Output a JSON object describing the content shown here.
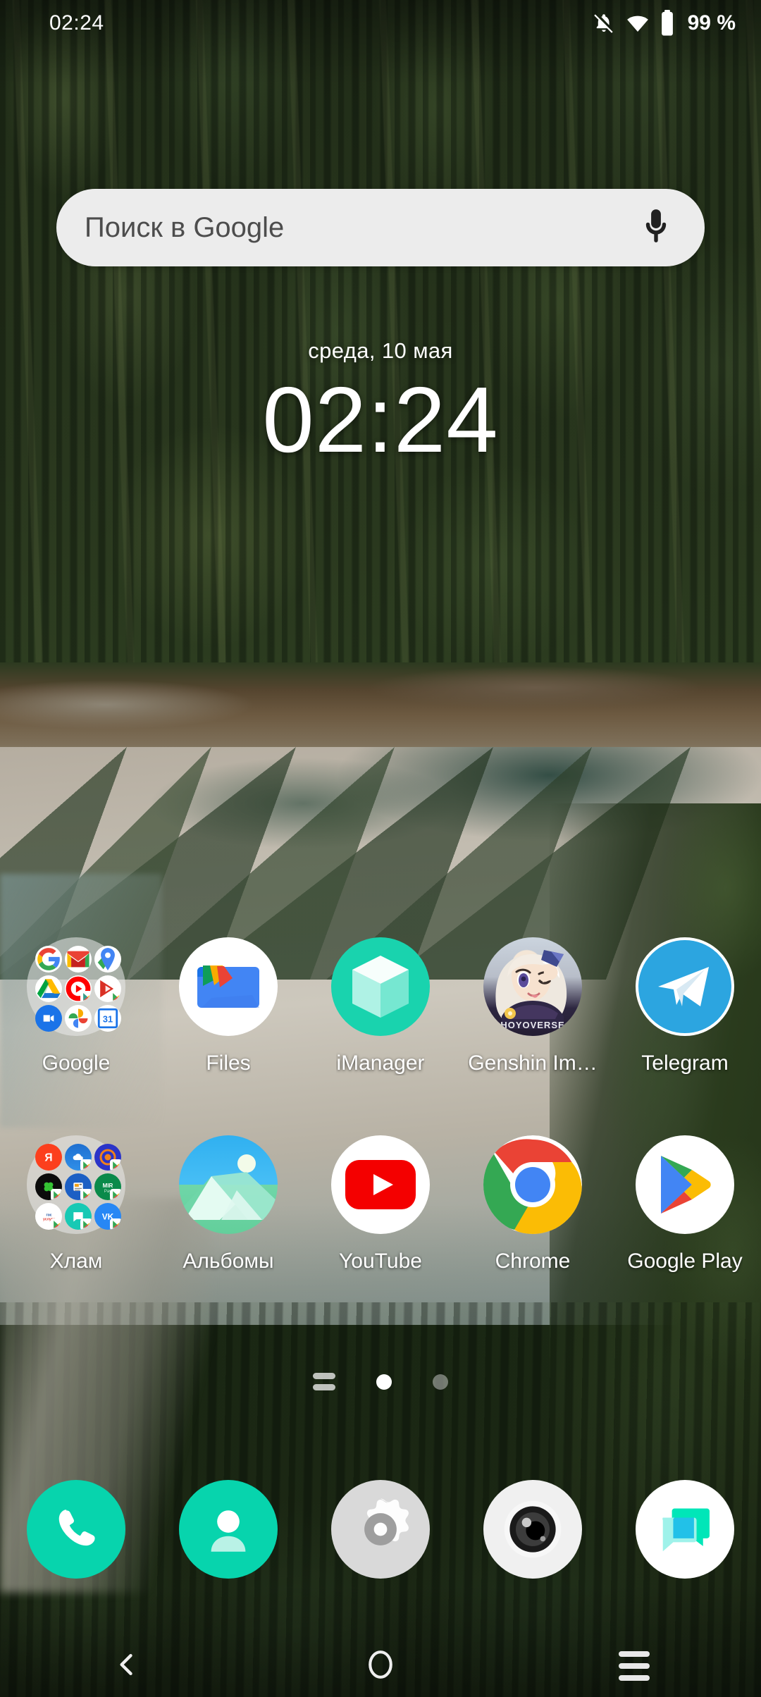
{
  "status_bar": {
    "time": "02:24",
    "battery_text": "99 %",
    "icons": [
      "bell-off-icon",
      "wifi-icon",
      "battery-icon"
    ]
  },
  "search": {
    "placeholder": "Поиск в Google",
    "mic_icon": "microphone-icon",
    "background_color": "#ececec"
  },
  "clock_widget": {
    "date": "среда, 10 мая",
    "time": "02:24"
  },
  "app_grid": {
    "rows": [
      [
        {
          "label": "Google",
          "type": "folder",
          "icon": "google-folder-icon"
        },
        {
          "label": "Files",
          "type": "app",
          "icon": "files-icon"
        },
        {
          "label": "iManager",
          "type": "app",
          "icon": "imanager-icon"
        },
        {
          "label": "Genshin Im…",
          "type": "app",
          "icon": "genshin-impact-icon"
        },
        {
          "label": "Telegram",
          "type": "app",
          "icon": "telegram-icon"
        }
      ],
      [
        {
          "label": "Хлам",
          "type": "folder",
          "icon": "junk-folder-icon"
        },
        {
          "label": "Альбомы",
          "type": "app",
          "icon": "albums-icon"
        },
        {
          "label": "YouTube",
          "type": "app",
          "icon": "youtube-icon"
        },
        {
          "label": "Chrome",
          "type": "app",
          "icon": "chrome-icon"
        },
        {
          "label": "Google Play",
          "type": "app",
          "icon": "google-play-icon"
        }
      ]
    ],
    "folders": {
      "google": {
        "name": "Google",
        "apps": [
          "google-search",
          "gmail",
          "maps",
          "drive",
          "youtube-music",
          "play-store",
          "meet",
          "photos",
          "calendar"
        ]
      },
      "junk": {
        "name": "Хлам",
        "apps": [
          "yandex",
          "cloud",
          "target",
          "clover",
          "news",
          "mir-pay",
          "gosuslugi",
          "messages",
          "vk"
        ]
      }
    }
  },
  "page_indicator": {
    "widget_handle": "widget-dash-icon",
    "pages": 2,
    "active_page": 1
  },
  "dock": {
    "items": [
      {
        "label": "Phone",
        "icon": "phone-icon",
        "color": "#07d4ad"
      },
      {
        "label": "Contacts",
        "icon": "contacts-icon",
        "color": "#07d4ad"
      },
      {
        "label": "Settings",
        "icon": "settings-gear-icon",
        "color": "#d9d9d9"
      },
      {
        "label": "Camera",
        "icon": "camera-icon",
        "color": "#ffffff"
      },
      {
        "label": "Messages",
        "icon": "messages-icon",
        "color": "#ffffff"
      }
    ]
  },
  "nav_bar": {
    "back": "back-chevron-icon",
    "home": "home-circle-icon",
    "recents": "recents-lines-icon"
  },
  "wallpaper": {
    "description": "aerial-forest-lake-photo",
    "dominant_colors": [
      "#1f2b16",
      "#6d5a41",
      "#c2bcb0",
      "#2a3b1d"
    ]
  }
}
